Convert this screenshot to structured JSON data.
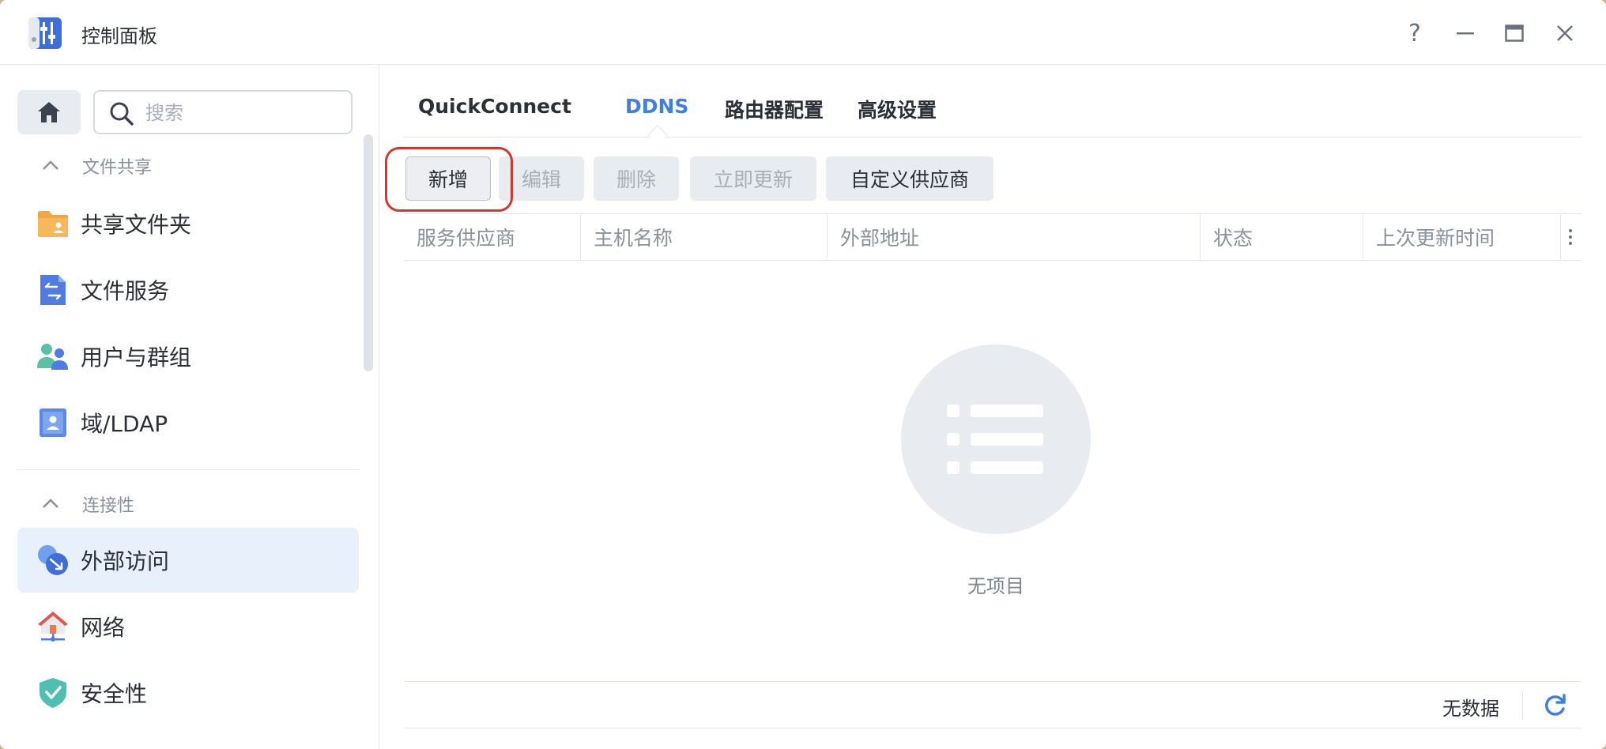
{
  "window": {
    "title": "控制面板",
    "help_label": "?"
  },
  "sidebar": {
    "search_placeholder": "搜索",
    "sections": [
      {
        "label": "文件共享"
      },
      {
        "label": "连接性"
      }
    ],
    "items": [
      {
        "label": "共享文件夹"
      },
      {
        "label": "文件服务"
      },
      {
        "label": "用户与群组"
      },
      {
        "label": "域/LDAP"
      },
      {
        "label": "外部访问",
        "active": true
      },
      {
        "label": "网络"
      },
      {
        "label": "安全性"
      }
    ]
  },
  "tabs": [
    {
      "label": "QuickConnect"
    },
    {
      "label": "DDNS",
      "active": true
    },
    {
      "label": "路由器配置"
    },
    {
      "label": "高级设置"
    }
  ],
  "toolbar": {
    "add": "新增",
    "edit": "编辑",
    "delete": "删除",
    "update_now": "立即更新",
    "custom_provider": "自定义供应商"
  },
  "table": {
    "columns": [
      "服务供应商",
      "主机名称",
      "外部地址",
      "状态",
      "上次更新时间"
    ]
  },
  "empty_state": {
    "label": "无项目"
  },
  "footer": {
    "status": "无数据"
  },
  "colors": {
    "accent": "#3f7fe0",
    "highlight": "#d6362b",
    "active_bg": "#e8f0fc"
  }
}
